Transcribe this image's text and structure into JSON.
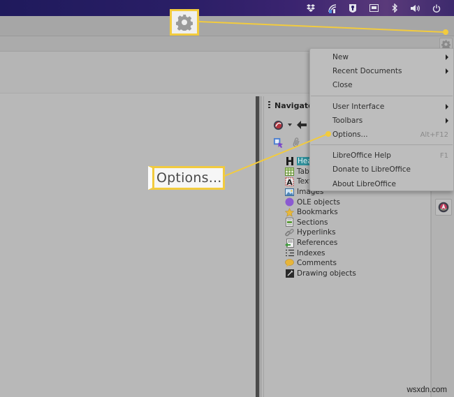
{
  "desktop_panel": {
    "tray_icons": [
      "dropbox-icon",
      "network-icon",
      "keepassxc-icon",
      "wired-network-icon",
      "bluetooth-icon",
      "volume-icon",
      "power-icon"
    ]
  },
  "window": {
    "sidebar_menu_icon": "gear-icon"
  },
  "navigator": {
    "title": "Navigator",
    "toolbar_row1": [
      "content-view-icon",
      "dropdown-arrow-icon",
      "back-icon"
    ],
    "toolbar_row2": [
      "drag-mode-icon",
      "attachment-icon"
    ],
    "items": [
      {
        "icon": "heading-icon",
        "label": "Headings",
        "visible_label": "Hea",
        "selected": true
      },
      {
        "icon": "table-icon",
        "label": "Tables",
        "visible_label": "Tabl",
        "selected": false
      },
      {
        "icon": "text-frame-icon",
        "label": "Text frames",
        "visible_label": "Text",
        "selected": false
      },
      {
        "icon": "image-icon",
        "label": "Images",
        "visible_label": "Images",
        "selected": false
      },
      {
        "icon": "ole-object-icon",
        "label": "OLE objects",
        "visible_label": "OLE objects",
        "selected": false
      },
      {
        "icon": "bookmark-icon",
        "label": "Bookmarks",
        "visible_label": "Bookmarks",
        "selected": false
      },
      {
        "icon": "section-icon",
        "label": "Sections",
        "visible_label": "Sections",
        "selected": false
      },
      {
        "icon": "hyperlink-icon",
        "label": "Hyperlinks",
        "visible_label": "Hyperlinks",
        "selected": false
      },
      {
        "icon": "reference-icon",
        "label": "References",
        "visible_label": "References",
        "selected": false
      },
      {
        "icon": "index-icon",
        "label": "Indexes",
        "visible_label": "Indexes",
        "selected": false
      },
      {
        "icon": "comment-icon",
        "label": "Comments",
        "visible_label": "Comments",
        "selected": false
      },
      {
        "icon": "drawing-object-icon",
        "label": "Drawing objects",
        "visible_label": "Drawing objects",
        "selected": false
      }
    ]
  },
  "sidebar_tabs": [
    "navigator-tab-icon"
  ],
  "menu": {
    "groups": [
      [
        {
          "label": "New",
          "submenu": true,
          "accel": ""
        },
        {
          "label": "Recent Documents",
          "submenu": true,
          "accel": ""
        },
        {
          "label": "Close",
          "submenu": false,
          "accel": ""
        }
      ],
      [
        {
          "label": "User Interface",
          "submenu": true,
          "accel": ""
        },
        {
          "label": "Toolbars",
          "submenu": true,
          "accel": ""
        },
        {
          "label": "Options...",
          "submenu": false,
          "accel": "Alt+F12"
        }
      ],
      [
        {
          "label": "LibreOffice Help",
          "submenu": false,
          "accel": "F1"
        },
        {
          "label": "Donate to LibreOffice",
          "submenu": false,
          "accel": ""
        },
        {
          "label": "About LibreOffice",
          "submenu": false,
          "accel": ""
        }
      ]
    ]
  },
  "callouts": {
    "gear_icon": "gear-icon",
    "options_label": "Options...",
    "accent_color": "#f2cb3e"
  },
  "watermark": "wsxdn.com"
}
